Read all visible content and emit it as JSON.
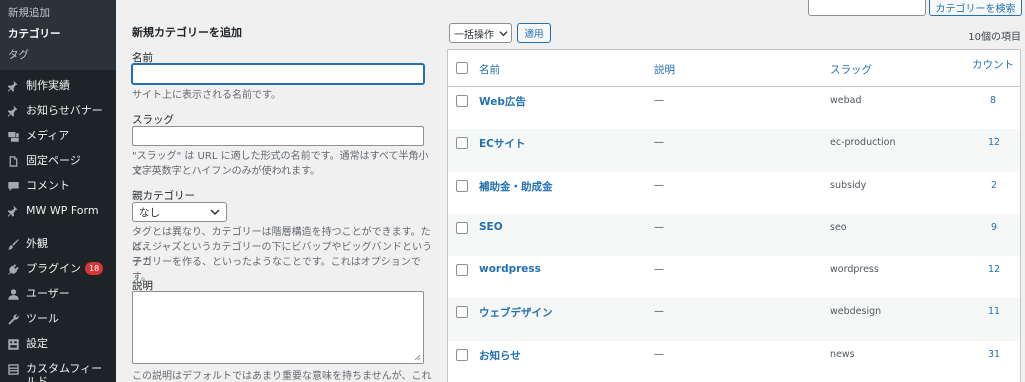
{
  "sidebar": {
    "submenu": [
      {
        "label": "新規追加"
      },
      {
        "label": "カテゴリー"
      },
      {
        "label": "タグ"
      }
    ],
    "items": [
      {
        "label": "制作実績",
        "icon": "pin-icon"
      },
      {
        "label": "お知らせバナー",
        "icon": "pin-icon"
      },
      {
        "label": "メディア",
        "icon": "media-icon"
      },
      {
        "label": "固定ページ",
        "icon": "page-icon"
      },
      {
        "label": "コメント",
        "icon": "comment-icon"
      },
      {
        "label": "MW WP Form",
        "icon": "pin-icon"
      },
      {
        "label": "外観",
        "icon": "brush-icon"
      },
      {
        "label": "プラグイン",
        "icon": "plugin-icon",
        "badge": "18"
      },
      {
        "label": "ユーザー",
        "icon": "user-icon"
      },
      {
        "label": "ツール",
        "icon": "wrench-icon"
      },
      {
        "label": "設定",
        "icon": "settings-icon"
      },
      {
        "label": "カスタムフィールド",
        "icon": "grid-icon"
      }
    ]
  },
  "form": {
    "title": "新規カテゴリーを追加",
    "name_label": "名前",
    "name_value": "",
    "name_desc": "サイト上に表示される名前です。",
    "slug_label": "スラッグ",
    "slug_value": "",
    "slug_desc_1": "\"スラッグ\" は URL に適した形式の名前です。通常はすべて半角小文字",
    "slug_desc_2": "で、英数字とハイフンのみが使われます。",
    "parent_label": "親カテゴリー",
    "parent_value": "なし",
    "parent_desc_1": "タグとは異なり、カテゴリーは階層構造を持つことができます。たとえ",
    "parent_desc_2": "ば、ジャズというカテゴリーの下にビバップやビッグバンドという子カ",
    "parent_desc_3": "テゴリーを作る、といったようなことです。これはオプションです。",
    "desc_label": "説明",
    "desc_value": "",
    "desc_desc": "この説明はデフォルトではあまり重要な意味を持ちませんが、これを表"
  },
  "search": {
    "value": "",
    "button_label": "カテゴリーを検索"
  },
  "bulk": {
    "selected": "一括操作",
    "apply_label": "適用",
    "item_count": "10個の項目"
  },
  "table": {
    "headers": {
      "name": "名前",
      "description": "説明",
      "slug": "スラッグ",
      "count": "カウント"
    },
    "rows": [
      {
        "name": "Web広告",
        "description": "—",
        "slug": "webad",
        "count": "8"
      },
      {
        "name": "ECサイト",
        "description": "—",
        "slug": "ec-production",
        "count": "12"
      },
      {
        "name": "補助金・助成金",
        "description": "—",
        "slug": "subsidy",
        "count": "2"
      },
      {
        "name": "SEO",
        "description": "—",
        "slug": "seo",
        "count": "9"
      },
      {
        "name": "wordpress",
        "description": "—",
        "slug": "wordpress",
        "count": "12"
      },
      {
        "name": "ウェブデザイン",
        "description": "—",
        "slug": "webdesign",
        "count": "11"
      },
      {
        "name": "お知らせ",
        "description": "—",
        "slug": "news",
        "count": "31"
      }
    ]
  },
  "colors": {
    "sidebar_bg": "#1d2327",
    "link": "#2271b1",
    "badge": "#d63638"
  }
}
